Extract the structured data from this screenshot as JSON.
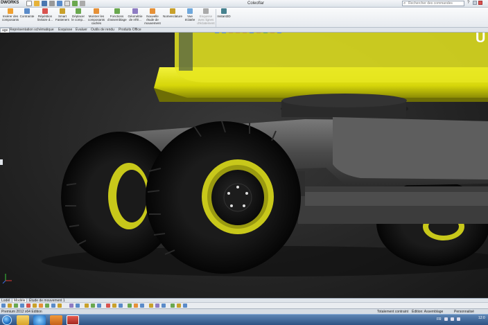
{
  "titlebar": {
    "logo": "DWORKS",
    "title": "Coleoflar",
    "search_placeholder": "Rechercher des commandes",
    "help": "?"
  },
  "ribbon": {
    "buttons": [
      {
        "label": "Insérer des composants",
        "icon": "insert-components-icon",
        "color": "#f0a030"
      },
      {
        "label": "Contrainte",
        "icon": "mate-icon",
        "color": "#5a8bc9"
      },
      {
        "label": "Répétition linéaire d...",
        "icon": "linear-pattern-icon",
        "color": "#d9534f"
      },
      {
        "label": "Smart Fasteners",
        "icon": "smart-fasteners-icon",
        "color": "#c9a12b"
      },
      {
        "label": "Déplacer le comp...",
        "icon": "move-component-icon",
        "color": "#6aa84f"
      },
      {
        "label": "Montrer les composants cachés",
        "icon": "show-hidden-icon",
        "color": "#e69138"
      },
      {
        "label": "Fonctions d'assemblage",
        "icon": "assembly-features-icon",
        "color": "#6aa84f"
      },
      {
        "label": "Géométrie de réfé...",
        "icon": "reference-geometry-icon",
        "color": "#8e7cc3"
      },
      {
        "label": "Nouvelle étude de mouvement",
        "icon": "new-motion-study-icon",
        "color": "#e69138"
      },
      {
        "label": "Nomenclature",
        "icon": "bom-icon",
        "color": "#c9a12b"
      },
      {
        "label": "Vue éclatée",
        "icon": "exploded-view-icon",
        "color": "#6fa8dc"
      },
      {
        "label": "Esquisse avec lignes d'éclatement",
        "icon": "explode-line-sketch-icon",
        "color": "#aaaaaa"
      },
      {
        "label": "Instant3D",
        "icon": "instant3d-icon",
        "color": "#45818e"
      }
    ]
  },
  "tabs": [
    "age",
    "Représentation schématique",
    "Esquisse",
    "Évaluer",
    "Outils de rendu",
    "Produits Office"
  ],
  "model_tabs": [
    "Lodèl",
    "Modèle",
    "Étude de mouvement 1"
  ],
  "status": {
    "left": "Premium 2012 x64 Edition",
    "constraint": "Totalement contraint",
    "mode": "Édition: Assemblage",
    "custom": "Personnalisé"
  },
  "taskbar": {
    "apps": [
      "explorer",
      "ie",
      "media",
      "solidworks"
    ],
    "tray_lang": "FR",
    "clock": "12:0"
  },
  "colors": {
    "body_yellow": "#d6d60a",
    "rim_yellow": "#c8c81a",
    "tire_black": "#0c0c0c",
    "background": "#262626"
  }
}
